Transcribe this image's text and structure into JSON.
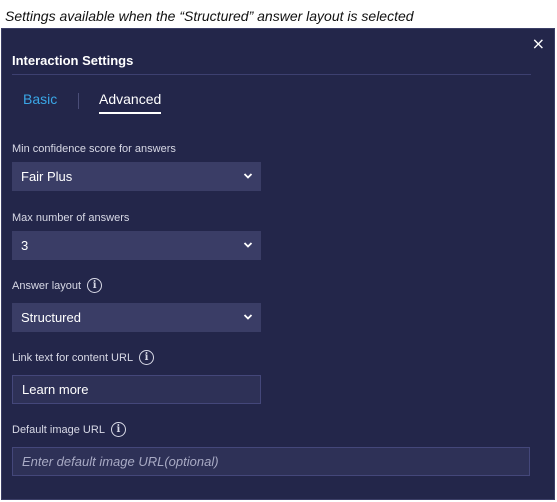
{
  "caption": "Settings available when the “Structured” answer layout is selected",
  "dialog": {
    "title": "Interaction Settings",
    "close_glyph": "×",
    "tabs": [
      {
        "label": "Basic",
        "active": false
      },
      {
        "label": "Advanced",
        "active": true
      }
    ]
  },
  "fields": {
    "min_confidence": {
      "label": "Min confidence score for answers",
      "value": "Fair Plus"
    },
    "max_answers": {
      "label": "Max number of answers",
      "value": "3"
    },
    "answer_layout": {
      "label": "Answer layout",
      "value": "Structured"
    },
    "link_text": {
      "label": "Link text for content URL",
      "value": "Learn more"
    },
    "default_image": {
      "label": "Default image URL",
      "placeholder": "Enter default image URL(optional)"
    }
  },
  "icons": {
    "info": "info-icon",
    "chevron": "chevron-down-icon",
    "close": "close-icon"
  },
  "colors": {
    "panel_bg": "#23264a",
    "accent": "#3aa6e6"
  }
}
